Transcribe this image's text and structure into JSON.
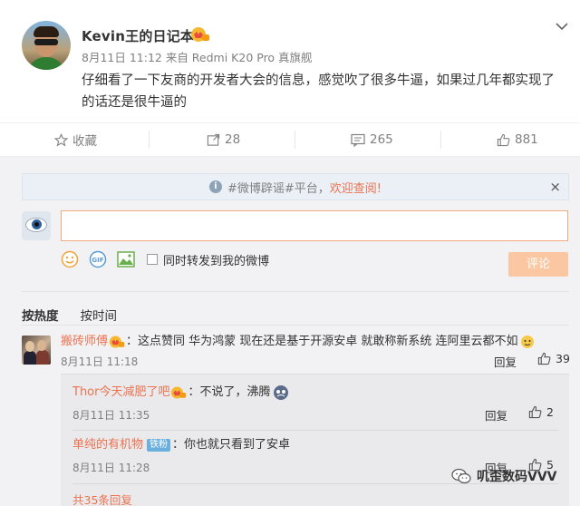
{
  "post": {
    "username": "Kevin王的日记本",
    "meta": "8月11日 11:12 来自 Redmi K20 Pro 真旗舰",
    "content": "仔细看了一下友商的开发者大会的信息，感觉吹了很多牛逼，如果过几年都实现了的话还是很牛逼的"
  },
  "actions": {
    "favorite_label": "收藏",
    "repost_count": "28",
    "comment_count": "265",
    "like_count": "881"
  },
  "comments_panel": {
    "notice_prefix": "#微博辟谣#平台，",
    "notice_highlight": "欢迎查阅!",
    "notice_close": "×",
    "input_value": "",
    "repost_checkbox_label": "同时转发到我的微博",
    "submit_label": "评论",
    "sort_hot": "按热度",
    "sort_time": "按时间"
  },
  "comments": [
    {
      "name": "搬砖师傅",
      "text": "：这点赞同  华为鸿蒙  现在还是基于开源安卓  就敢称新系统  连阿里云都不如",
      "time": "8月11日 11:18",
      "reply_label": "回复",
      "likes": "39"
    }
  ],
  "sub_comments": [
    {
      "name": "Thor今天减肥了吧",
      "text": "：不说了，沸腾",
      "time": "8月11日 11:35",
      "reply_label": "回复",
      "likes": "2"
    },
    {
      "name": "单纯的有机物",
      "badge": "铁粉",
      "text": "：你也就只看到了安卓",
      "time": "8月11日 11:28",
      "reply_label": "回复",
      "likes": "5"
    }
  ],
  "more_replies": "共35条回复",
  "watermark": "叽歪数码VVV",
  "colors": {
    "accent": "#eb7350",
    "submit_disabled": "#fbc7a3",
    "panel_bg": "#f2f2f5"
  }
}
